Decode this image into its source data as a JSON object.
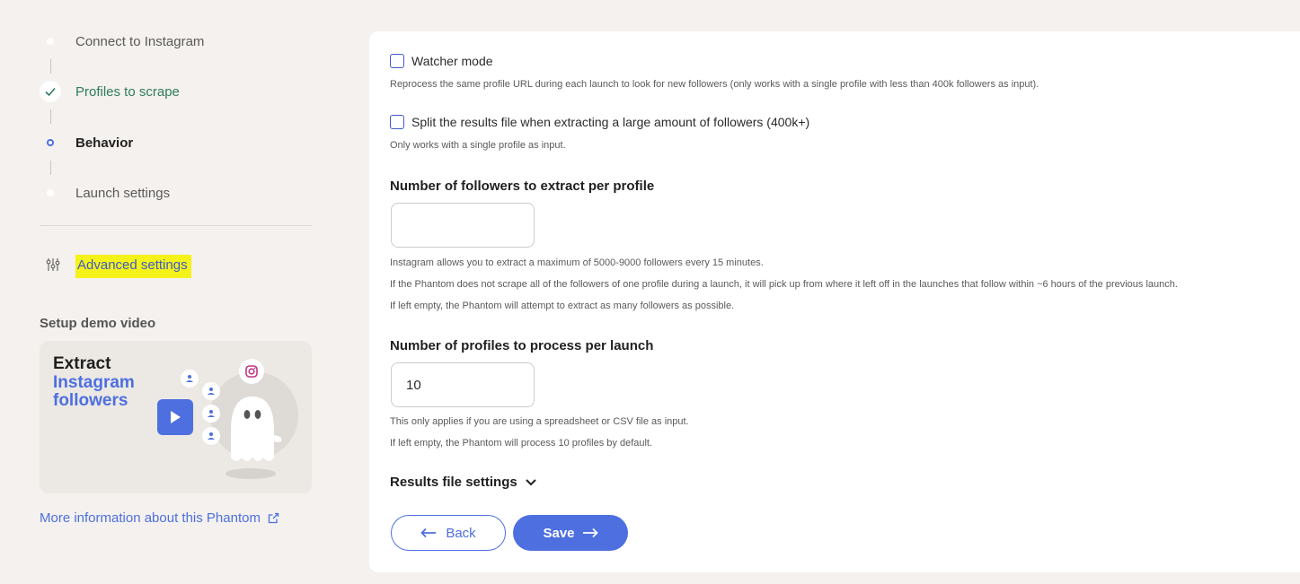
{
  "steps": [
    {
      "label": "Connect to Instagram",
      "state": "pending"
    },
    {
      "label": "Profiles to scrape",
      "state": "done"
    },
    {
      "label": "Behavior",
      "state": "current"
    },
    {
      "label": "Launch settings",
      "state": "pending"
    }
  ],
  "advanced_settings": {
    "label": "Advanced settings",
    "icon": "sliders-icon"
  },
  "demo": {
    "title": "Setup demo video",
    "card_line1": "Extract",
    "card_line2": "Instagram followers"
  },
  "more_info": {
    "label": "More information about this Phantom",
    "icon": "external-link-icon"
  },
  "form": {
    "watcher": {
      "label": "Watcher mode",
      "checked": false,
      "help": "Reprocess the same profile URL during each launch to look for new followers (only works with a single profile with less than 400k followers as input)."
    },
    "split": {
      "label": "Split the results file when extracting a large amount of followers (400k+)",
      "checked": false,
      "help": "Only works with a single profile as input."
    },
    "followers": {
      "title": "Number of followers to extract per profile",
      "value": "",
      "help1": "Instagram allows you to extract a maximum of 5000-9000 followers every 15 minutes.",
      "help2": "If the Phantom does not scrape all of the followers of one profile during a launch, it will pick up from where it left off in the launches that follow within ~6 hours of the previous launch.",
      "help3": "If left empty, the Phantom will attempt to extract as many followers as possible."
    },
    "profiles": {
      "title": "Number of profiles to process per launch",
      "value": "10",
      "help1": "This only applies if you are using a spreadsheet or CSV file as input.",
      "help2": "If left empty, the Phantom will process 10 profiles by default."
    },
    "results_settings": {
      "label": "Results file settings"
    }
  },
  "buttons": {
    "back": "Back",
    "save": "Save"
  },
  "colors": {
    "accent": "#4d6fe0",
    "success": "#2e7d5b",
    "highlight": "#f5f21a",
    "background": "#f4f1ee"
  }
}
